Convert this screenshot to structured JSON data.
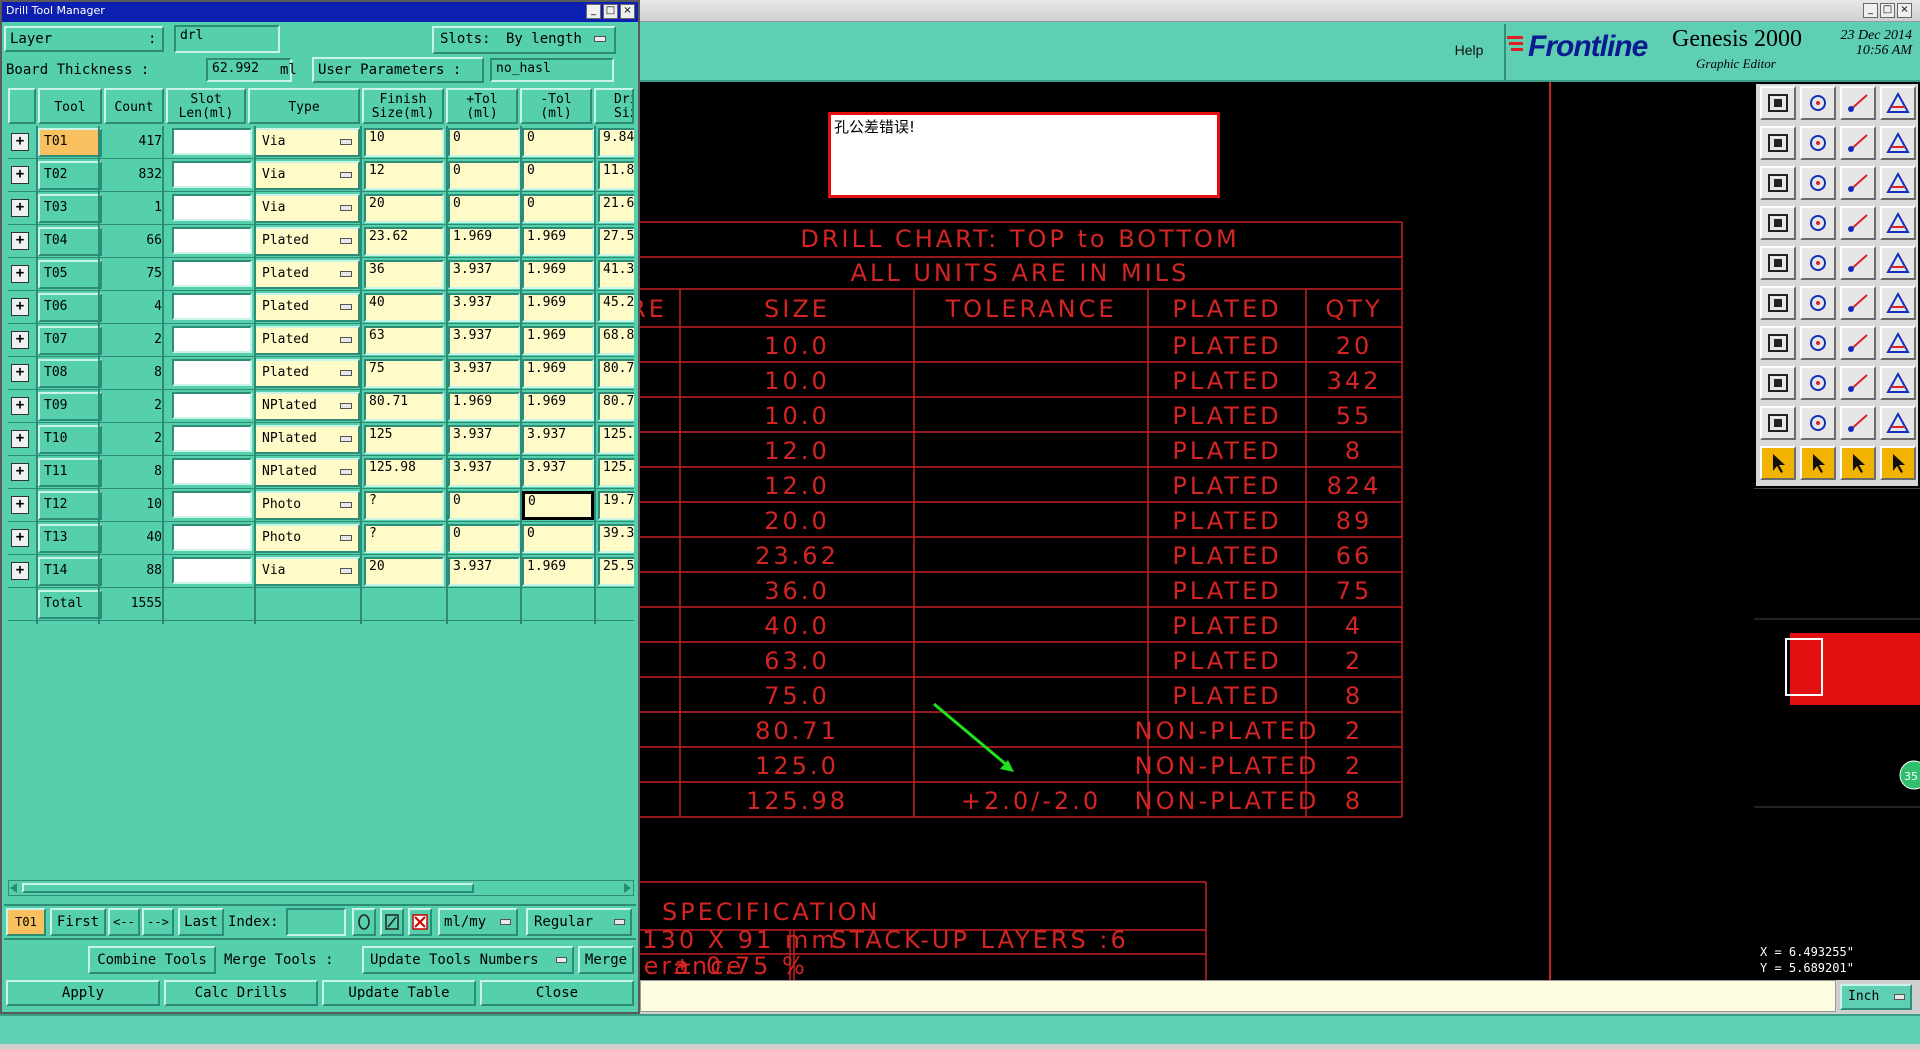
{
  "main_window": {
    "help": "Help",
    "brand": "Frontline",
    "product": "Genesis 2000",
    "subtitle": "Graphic Editor",
    "date": "23 Dec 2014",
    "time": "10:56 AM",
    "window_buttons": [
      "_",
      "□",
      "×"
    ],
    "units": "Inch",
    "coords": {
      "x": "X = 6.493255\"",
      "y": "Y = 5.689201\""
    },
    "side_badge": "35"
  },
  "error_popup": {
    "text": "孔公差错误!"
  },
  "chart_data": {
    "type": "table",
    "title": "DRILL CHART: TOP to BOTTOM",
    "subtitle": "ALL UNITS ARE IN MILS",
    "columns": [
      "RE",
      "SIZE",
      "TOLERANCE",
      "PLATED",
      "QTY"
    ],
    "rows": [
      [
        "",
        "10.0",
        "",
        "PLATED",
        "20"
      ],
      [
        "",
        "10.0",
        "",
        "PLATED",
        "342"
      ],
      [
        "",
        "10.0",
        "",
        "PLATED",
        "55"
      ],
      [
        "",
        "12.0",
        "",
        "PLATED",
        "8"
      ],
      [
        "",
        "12.0",
        "",
        "PLATED",
        "824"
      ],
      [
        "",
        "20.0",
        "",
        "PLATED",
        "89"
      ],
      [
        "",
        "23.62",
        "",
        "PLATED",
        "66"
      ],
      [
        "",
        "36.0",
        "",
        "PLATED",
        "75"
      ],
      [
        "",
        "40.0",
        "",
        "PLATED",
        "4"
      ],
      [
        "",
        "63.0",
        "",
        "PLATED",
        "2"
      ],
      [
        "",
        "75.0",
        "",
        "PLATED",
        "8"
      ],
      [
        "",
        "80.71",
        "",
        "NON-PLATED",
        "2"
      ],
      [
        "",
        "125.0",
        "",
        "NON-PLATED",
        "2"
      ],
      [
        "",
        "125.98",
        "+2.0/-2.0",
        "NON-PLATED",
        "8"
      ]
    ],
    "spec_title": "SPECIFICATION",
    "spec_cells": [
      "130 X 91 mm",
      "STACK-UP LAYERS :6",
      "lerance",
      "± 0.75 %"
    ]
  },
  "dialog": {
    "title": "Drill Tool Manager",
    "layer_label": "Layer",
    "layer_colon": ":",
    "layer_value": "drl",
    "slots_label": "Slots:",
    "slots_value": "By length",
    "board_thickness_label": "Board Thickness :",
    "board_thickness_value": "62.992",
    "board_thickness_unit": "ml",
    "user_params_label": "User Parameters :",
    "user_params_value": "no_hasl",
    "headers": {
      "tool": "Tool",
      "count": "Count",
      "slot1": "Slot",
      "slot2": "Len(ml)",
      "type": "Type",
      "finish1": "Finish",
      "finish2": "Size(ml)",
      "ptol1": "+Tol",
      "ptol2": "(ml)",
      "ntol1": "-Tol",
      "ntol2": "(ml)",
      "dri1": "Dri",
      "dri2": "Size"
    },
    "rows": [
      {
        "expand": "+",
        "tool": "T01",
        "count": "417",
        "type": "Via",
        "finish": "10",
        "ptol": "0",
        "ntol": "0",
        "dri": "9.84"
      },
      {
        "expand": "+",
        "tool": "T02",
        "count": "832",
        "type": "Via",
        "finish": "12",
        "ptol": "0",
        "ntol": "0",
        "dri": "11.8"
      },
      {
        "expand": "+",
        "tool": "T03",
        "count": "1",
        "type": "Via",
        "finish": "20",
        "ptol": "0",
        "ntol": "0",
        "dri": "21.6"
      },
      {
        "expand": "+",
        "tool": "T04",
        "count": "66",
        "type": "Plated",
        "finish": "23.62",
        "ptol": "1.969",
        "ntol": "1.969",
        "dri": "27.5"
      },
      {
        "expand": "+",
        "tool": "T05",
        "count": "75",
        "type": "Plated",
        "finish": "36",
        "ptol": "3.937",
        "ntol": "1.969",
        "dri": "41.3"
      },
      {
        "expand": "+",
        "tool": "T06",
        "count": "4",
        "type": "Plated",
        "finish": "40",
        "ptol": "3.937",
        "ntol": "1.969",
        "dri": "45.2"
      },
      {
        "expand": "+",
        "tool": "T07",
        "count": "2",
        "type": "Plated",
        "finish": "63",
        "ptol": "3.937",
        "ntol": "1.969",
        "dri": "68.8"
      },
      {
        "expand": "+",
        "tool": "T08",
        "count": "8",
        "type": "Plated",
        "finish": "75",
        "ptol": "3.937",
        "ntol": "1.969",
        "dri": "80.7"
      },
      {
        "expand": "+",
        "tool": "T09",
        "count": "2",
        "type": "NPlated",
        "finish": "80.71",
        "ptol": "1.969",
        "ntol": "1.969",
        "dri": "80.7"
      },
      {
        "expand": "+",
        "tool": "T10",
        "count": "2",
        "type": "NPlated",
        "finish": "125",
        "ptol": "3.937",
        "ntol": "3.937",
        "dri": "125."
      },
      {
        "expand": "+",
        "tool": "T11",
        "count": "8",
        "type": "NPlated",
        "finish": "125.98",
        "ptol": "3.937",
        "ntol": "3.937",
        "dri": "125."
      },
      {
        "expand": "+",
        "tool": "T12",
        "count": "10",
        "type": "Photo",
        "finish": "?",
        "ptol": "0",
        "ntol": "0",
        "dri": "19.7"
      },
      {
        "expand": "+",
        "tool": "T13",
        "count": "40",
        "type": "Photo",
        "finish": "?",
        "ptol": "0",
        "ntol": "0",
        "dri": "39.3"
      },
      {
        "expand": "+",
        "tool": "T14",
        "count": "88",
        "type": "Via",
        "finish": "20",
        "ptol": "3.937",
        "ntol": "1.969",
        "dri": "25.5"
      }
    ],
    "total_label": "Total",
    "total_count": "1555",
    "nav": {
      "current_tool": "T01",
      "first": "First",
      "prev": "<--",
      "next": "-->",
      "last": "Last",
      "index_label": "Index:",
      "unit_select": "ml/my",
      "mode_select": "Regular"
    },
    "actions": {
      "combine": "Combine Tools",
      "merge_label": "Merge Tools :",
      "update_numbers": "Update Tools Numbers",
      "merge": "Merge",
      "apply": "Apply",
      "calc": "Calc Drills",
      "update_table": "Update Table",
      "close": "Close"
    }
  }
}
